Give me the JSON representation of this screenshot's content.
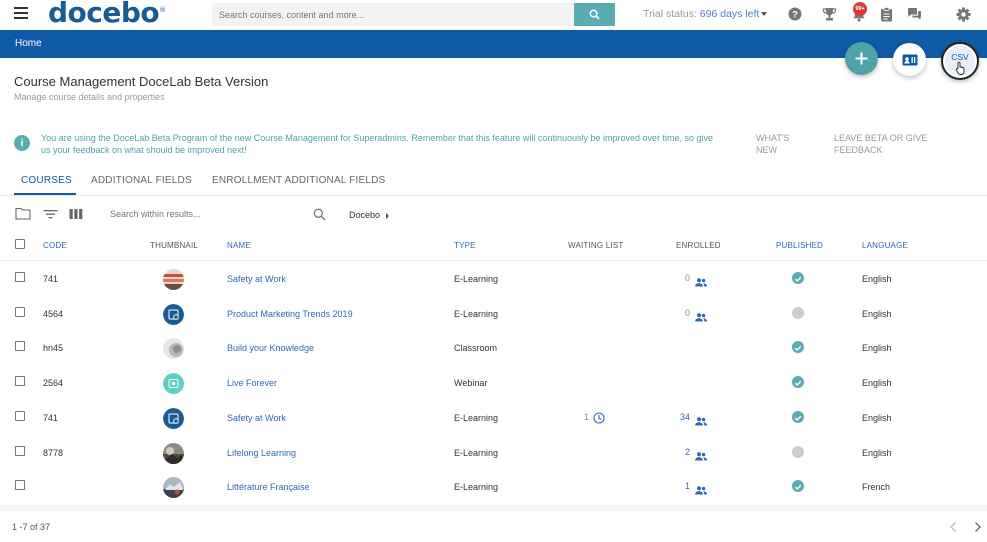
{
  "header": {
    "logo": "docebo",
    "logo_mark": "®",
    "search_placeholder": "Search courses, content and more...",
    "trial_label": "Trial status:",
    "trial_value": "696 days left",
    "notifications_badge": "99+"
  },
  "breadcrumb": {
    "home": "Home"
  },
  "actions": {
    "csv": "CSV"
  },
  "page": {
    "title": "Course Management DoceLab Beta Version",
    "subtitle": "Manage course details and properties"
  },
  "banner": {
    "text": "You are using the DoceLab Beta Program of the new Course Management for Superadmins. Remember that this feature will continuously be improved over time, so give us your feedback on what should be improved next!",
    "whats_new": "WHAT'S NEW",
    "leave_beta": "LEAVE BETA OR GIVE FEEDBACK"
  },
  "tabs": [
    {
      "label": "COURSES"
    },
    {
      "label": "ADDITIONAL FIELDS"
    },
    {
      "label": "ENROLLMENT ADDITIONAL FIELDS"
    }
  ],
  "toolbar": {
    "search_placeholder": "Search within results...",
    "branch": "Docebo"
  },
  "table": {
    "headers": {
      "code": "CODE",
      "thumbnail": "THUMBNAIL",
      "name": "NAME",
      "type": "TYPE",
      "waiting_list": "WAITING LIST",
      "enrolled": "ENROLLED",
      "published": "PUBLISHED",
      "language": "LANGUAGE"
    },
    "rows": [
      {
        "code": "741",
        "name": "Safety at Work",
        "type": "E-Learning",
        "waiting": "",
        "enrolled": "0",
        "published": true,
        "language": "English"
      },
      {
        "code": "4564",
        "name": "Product Marketing Trends 2019",
        "type": "E-Learning",
        "waiting": "",
        "enrolled": "0",
        "published": false,
        "language": "English"
      },
      {
        "code": "hn45",
        "name": "Build your Knowledge",
        "type": "Classroom",
        "waiting": "",
        "enrolled": "",
        "published": true,
        "language": "English"
      },
      {
        "code": "2564",
        "name": "Live Forever",
        "type": "Webinar",
        "waiting": "",
        "enrolled": "",
        "published": true,
        "language": "English"
      },
      {
        "code": "741",
        "name": "Safety at Work",
        "type": "E-Learning",
        "waiting": "1",
        "enrolled": "34",
        "published": true,
        "language": "English"
      },
      {
        "code": "8778",
        "name": "Lifelong Learning",
        "type": "E-Learning",
        "waiting": "",
        "enrolled": "2",
        "published": false,
        "language": "English"
      },
      {
        "code": "",
        "name": "Littérature Française",
        "type": "E-Learning",
        "waiting": "",
        "enrolled": "1",
        "published": true,
        "language": "French"
      }
    ]
  },
  "pager": {
    "text": "1 -7 of 37"
  },
  "colors": {
    "brand_blue": "#0e5aa7",
    "teal": "#4fa3a8",
    "link_blue": "#2e6ab0",
    "published": "#5aacb1",
    "unpublished": "#cccccc"
  }
}
